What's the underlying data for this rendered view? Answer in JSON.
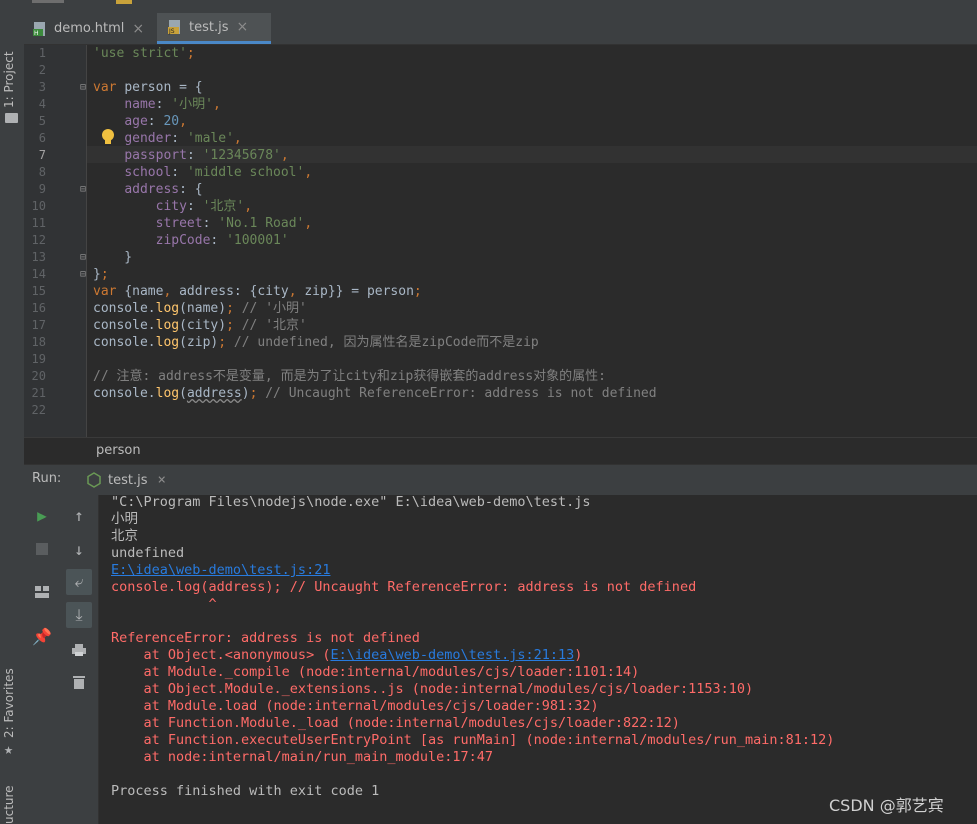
{
  "left_strip": {
    "project": "1: Project",
    "favorites": "2: Favorites",
    "structure": "ucture"
  },
  "tabs": [
    {
      "label": "demo.html",
      "icon": "html-file-icon",
      "active": false
    },
    {
      "label": "test.js",
      "icon": "js-file-icon",
      "active": true
    }
  ],
  "editor": {
    "line_numbers": [
      "1",
      "2",
      "3",
      "4",
      "5",
      "6",
      "7",
      "8",
      "9",
      "10",
      "11",
      "12",
      "13",
      "14",
      "15",
      "16",
      "17",
      "18",
      "19",
      "20",
      "21",
      "22"
    ],
    "current_line": "7",
    "breadcrumb": "person"
  },
  "run": {
    "title": "Run:",
    "tab_label": "test.js"
  },
  "console": {
    "cmd": "\"C:\\Program Files\\nodejs\\node.exe\" E:\\idea\\web-demo\\test.js",
    "out1": "小明",
    "out2": "北京",
    "out3": "undefined",
    "link1": "E:\\idea\\web-demo\\test.js:21",
    "err_line": "console.log(address); // Uncaught ReferenceError: address is not defined",
    "caret": "            ^",
    "err_title": "ReferenceError: address is not defined",
    "at1_pre": "    at Object.<anonymous> (",
    "at1_link": "E:\\idea\\web-demo\\test.js:21:13",
    "at1_post": ")",
    "at2": "    at Module._compile (node:internal/modules/cjs/loader:1101:14)",
    "at3": "    at Object.Module._extensions..js (node:internal/modules/cjs/loader:1153:10)",
    "at4": "    at Module.load (node:internal/modules/cjs/loader:981:32)",
    "at5": "    at Function.Module._load (node:internal/modules/cjs/loader:822:12)",
    "at6": "    at Function.executeUserEntryPoint [as runMain] (node:internal/modules/run_main:81:12)",
    "at7": "    at node:internal/main/run_main_module:17:47",
    "exit": "Process finished with exit code 1"
  },
  "watermark": "CSDN @郭艺宾",
  "colors": {
    "keyword": "#cc7832",
    "string": "#6a8759",
    "property": "#9876aa",
    "number": "#6897bb",
    "function": "#ffc66d",
    "comment": "#808080",
    "error": "#ff6b68",
    "link": "#287bde"
  }
}
